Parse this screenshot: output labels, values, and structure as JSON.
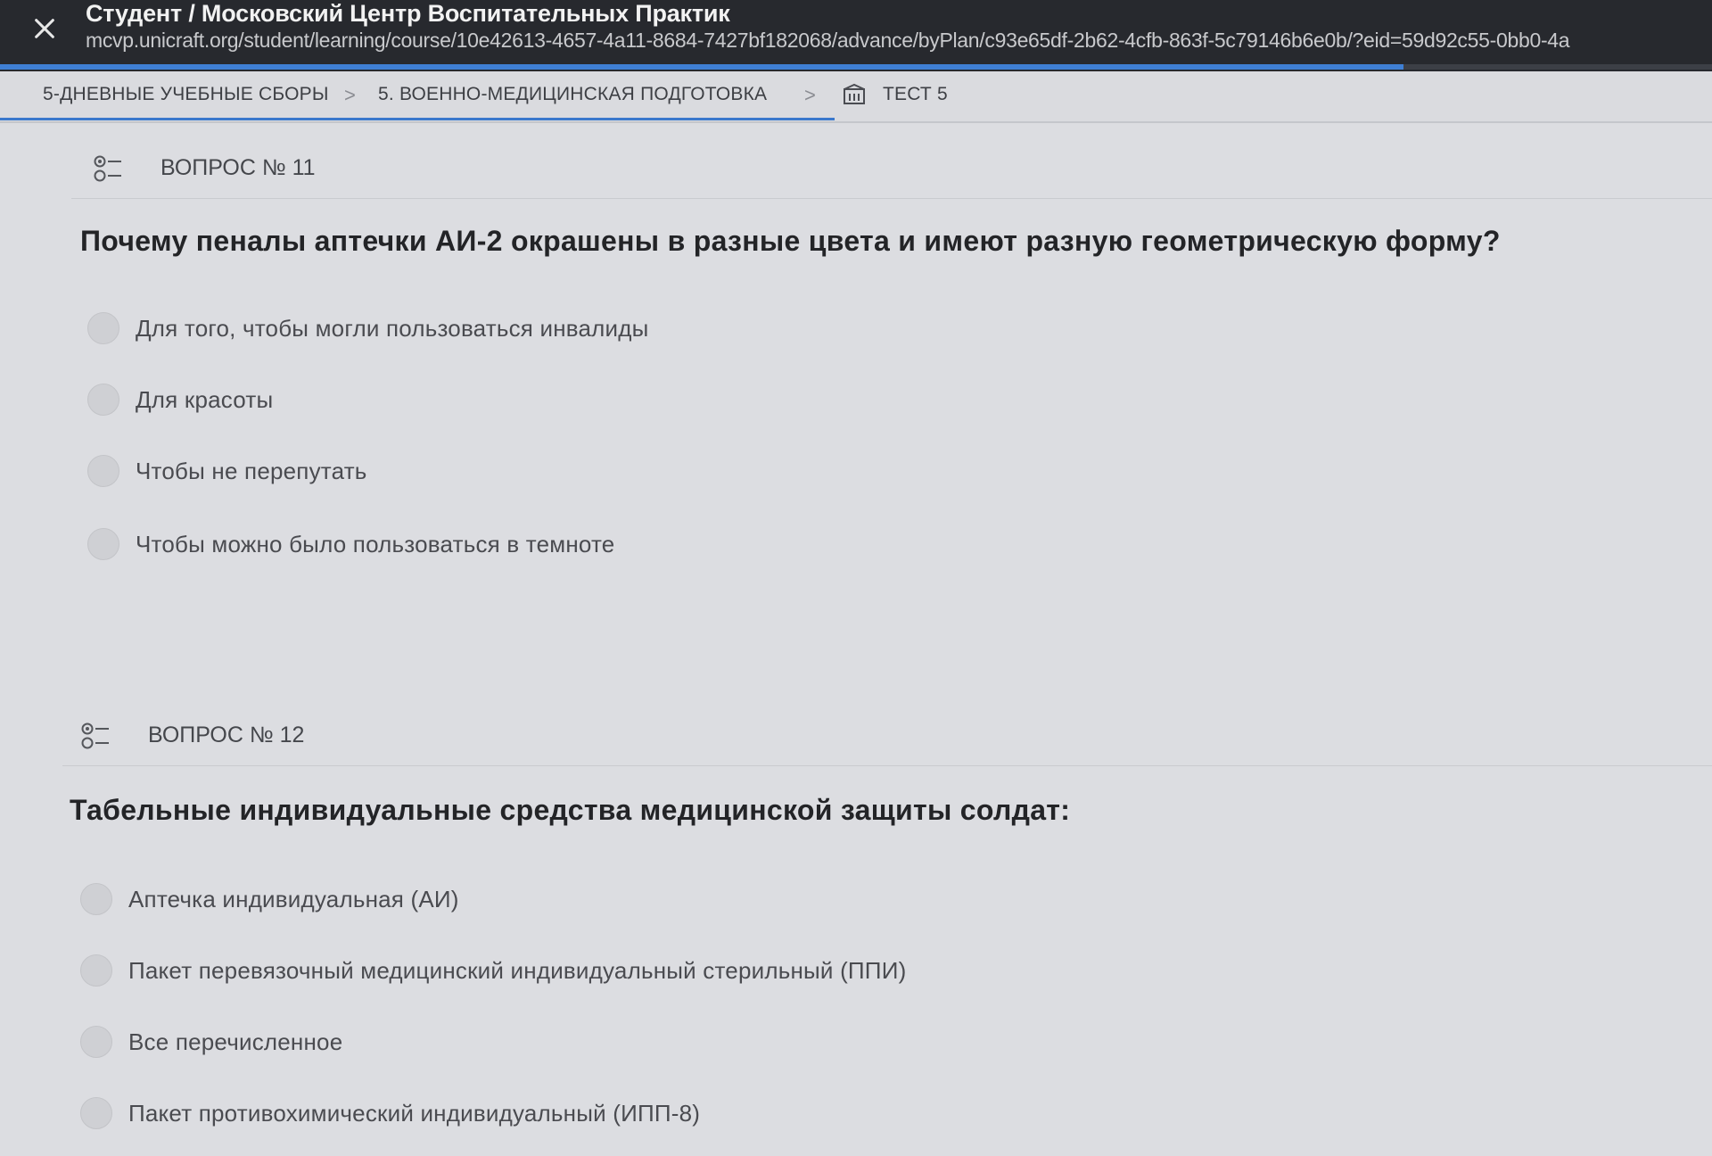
{
  "window": {
    "title": "Студент / Московский Центр Воспитательных Практик",
    "url": "mcvp.unicraft.org/student/learning/course/10e42613-4657-4a11-8684-7427bf182068/advance/byPlan/c93e65df-2b62-4cfb-863f-5c79146b6e0b/?eid=59d92c55-0bb0-4a",
    "progress_fraction": 0.82
  },
  "breadcrumb": {
    "items": [
      "5-ДНЕВНЫЕ УЧЕБНЫЕ СБОРЫ",
      "5. ВОЕННО-МЕДИЦИНСКАЯ ПОДГОТОВКА",
      "ТЕСТ 5"
    ],
    "separator": ">"
  },
  "questions": [
    {
      "number": "ВОПРОС № 11",
      "text": "Почему пеналы аптечки АИ-2 окрашены в разные цвета и имеют разную геометрическую форму?",
      "options": [
        "Для того, чтобы могли пользоваться инвалиды",
        "Для красоты",
        "Чтобы не перепутать",
        "Чтобы можно было пользоваться в темноте"
      ]
    },
    {
      "number": "ВОПРОС № 12",
      "text": "Табельные индивидуальные средства медицинской защиты солдат:",
      "options": [
        "Аптечка индивидуальная (АИ)",
        "Пакет перевязочный медицинский индивидуальный стерильный (ППИ)",
        "Все перечисленное",
        "Пакет противохимический индивидуальный (ИПП-8)"
      ]
    }
  ],
  "colors": {
    "topbar": "#27292e",
    "accent": "#3a78cc",
    "background": "#dcdde1"
  }
}
